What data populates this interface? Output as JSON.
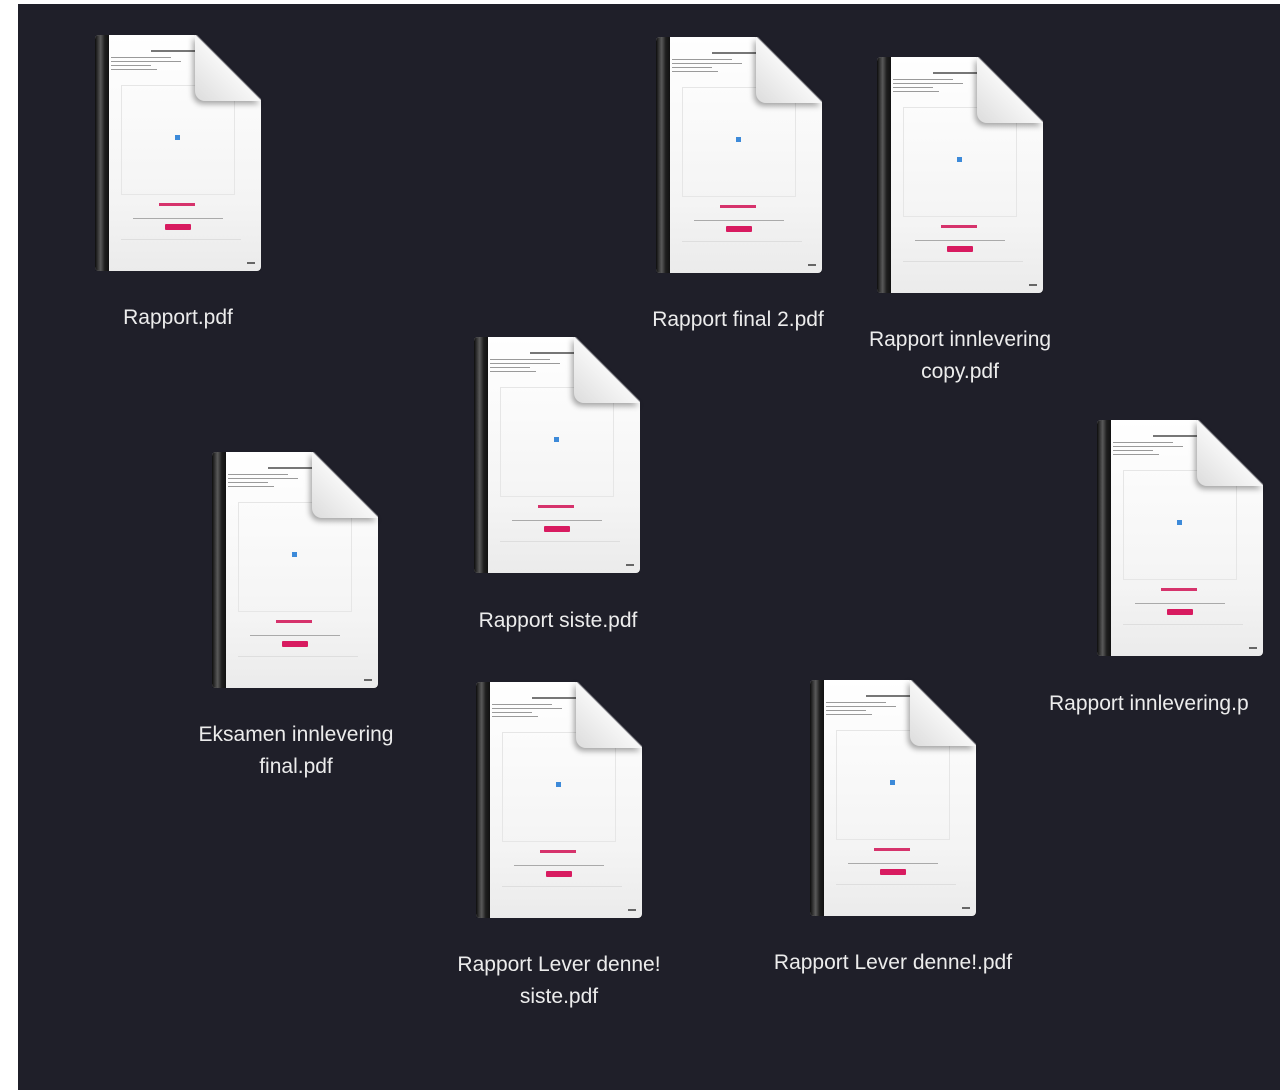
{
  "desktop": {
    "files": [
      {
        "id": "rapport",
        "name": "Rapport.pdf",
        "lines": [
          "Rapport.pdf"
        ]
      },
      {
        "id": "rapport-final-2",
        "name": "Rapport final 2.pdf",
        "lines": [
          "Rapport final 2.pdf"
        ]
      },
      {
        "id": "rapport-innlevering-copy",
        "name": "Rapport innlevering copy.pdf",
        "lines": [
          "Rapport innlevering",
          "copy.pdf"
        ]
      },
      {
        "id": "rapport-siste",
        "name": "Rapport siste.pdf",
        "lines": [
          "Rapport siste.pdf"
        ]
      },
      {
        "id": "eksamen-innlevering-final",
        "name": "Eksamen innlevering final.pdf",
        "lines": [
          "Eksamen innlevering",
          "final.pdf"
        ]
      },
      {
        "id": "rapport-innlevering",
        "name": "Rapport innlevering.pdf",
        "lines": [
          "Rapport innlevering.p"
        ]
      },
      {
        "id": "rapport-lever-denne-siste",
        "name": "Rapport Lever denne! siste.pdf",
        "lines": [
          "Rapport Lever denne!",
          "siste.pdf"
        ]
      },
      {
        "id": "rapport-lever-denne",
        "name": "Rapport Lever denne!.pdf",
        "lines": [
          "Rapport Lever denne!.pdf"
        ]
      }
    ],
    "thumbnail": {
      "icon": "pdf-document-icon",
      "accent_color": "#d81b60",
      "spine_color": "#1a1a1a"
    }
  }
}
